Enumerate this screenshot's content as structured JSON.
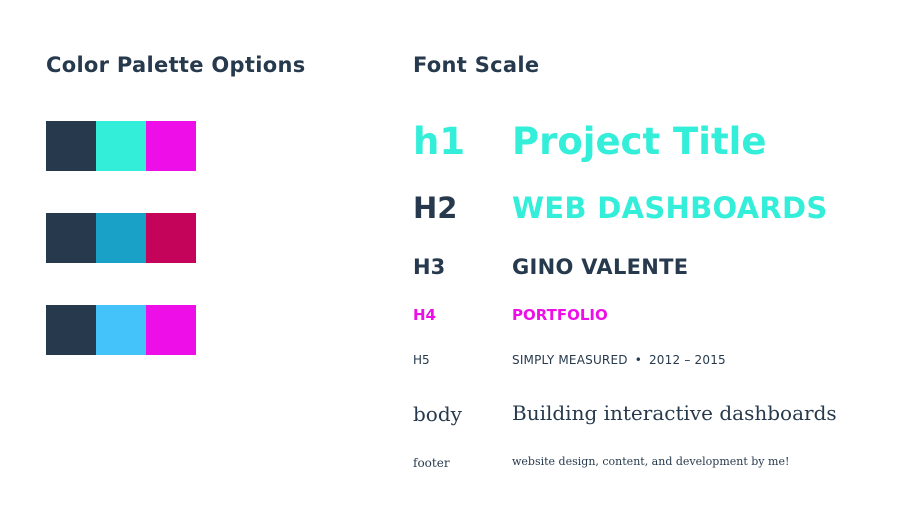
{
  "palette_section": {
    "title": "Color Palette Options",
    "palettes": [
      [
        "#273a4d",
        "#33eed8",
        "#ee0ee8"
      ],
      [
        "#273a4d",
        "#1aa1c8",
        "#c4035a"
      ],
      [
        "#273a4d",
        "#44c3fb",
        "#ee0ee8"
      ]
    ]
  },
  "font_scale": {
    "title": "Font Scale",
    "rows": {
      "h1": {
        "label": "h1",
        "sample": "Project Title",
        "color": "#33eed8"
      },
      "h2": {
        "label": "H2",
        "sample": "WEB DASHBOARDS",
        "color": "#33eed8"
      },
      "h3": {
        "label": "H3",
        "sample": "GINO VALENTE",
        "color": "#273a4d"
      },
      "h4": {
        "label": "H4",
        "sample": "PORTFOLIO",
        "color": "#ee0ee8"
      },
      "h5": {
        "label": "H5",
        "sample_company": "SIMPLY MEASURED",
        "sample_separator": "•",
        "sample_years": "2012 – 2015",
        "color": "#273a4d"
      },
      "body": {
        "label": "body",
        "sample": "Building interactive dashboards",
        "color": "#273a4d"
      },
      "footer": {
        "label": "footer",
        "sample": "website design, content, and development by me!",
        "color": "#273a4d"
      }
    }
  }
}
